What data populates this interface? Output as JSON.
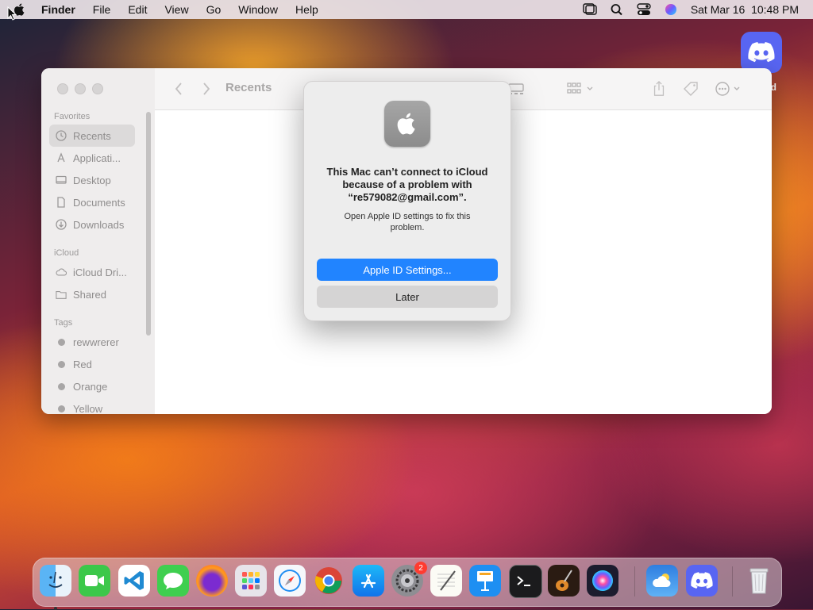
{
  "menubar": {
    "app_name": "Finder",
    "items": [
      "File",
      "Edit",
      "View",
      "Go",
      "Window",
      "Help"
    ],
    "clock": "Sat Mar 16  10:48 PM",
    "status_icons": [
      "stage-manager-icon",
      "search-icon",
      "control-center-icon",
      "siri-icon"
    ]
  },
  "desktop": {
    "icon_name": "discord-icon",
    "label": "rd"
  },
  "finder": {
    "title": "Recents",
    "sidebar": {
      "favorites_title": "Favorites",
      "favorites": [
        {
          "label": "Recents",
          "icon": "clock-icon"
        },
        {
          "label": "Applicati...",
          "icon": "applications-icon"
        },
        {
          "label": "Desktop",
          "icon": "desktop-icon"
        },
        {
          "label": "Documents",
          "icon": "document-icon"
        },
        {
          "label": "Downloads",
          "icon": "download-icon"
        }
      ],
      "icloud_title": "iCloud",
      "icloud": [
        {
          "label": "iCloud Dri...",
          "icon": "cloud-icon"
        },
        {
          "label": "Shared",
          "icon": "shared-folder-icon"
        }
      ],
      "tags_title": "Tags",
      "tags": [
        {
          "label": "rewwrerer",
          "color": "#a8a6a6"
        },
        {
          "label": "Red",
          "color": "#a8a6a6"
        },
        {
          "label": "Orange",
          "color": "#a8a6a6"
        },
        {
          "label": "Yellow",
          "color": "#a8a6a6"
        }
      ]
    }
  },
  "alert": {
    "icon": "apple-logo-icon",
    "title": "This Mac can’t connect to iCloud because of a problem with “re579082@gmail.com”.",
    "message": "Open Apple ID settings to fix this problem.",
    "primary_button": "Apple ID Settings...",
    "secondary_button": "Later",
    "primary_color": "#2184ff"
  },
  "dock": {
    "apps": [
      {
        "name": "Finder",
        "icon": "finder-icon"
      },
      {
        "name": "FaceTime",
        "icon": "facetime-icon"
      },
      {
        "name": "Visual Studio Code",
        "icon": "vscode-icon"
      },
      {
        "name": "Messages",
        "icon": "messages-icon"
      },
      {
        "name": "Firefox",
        "icon": "firefox-icon"
      },
      {
        "name": "Launchpad",
        "icon": "launchpad-icon"
      },
      {
        "name": "Safari",
        "icon": "safari-icon"
      },
      {
        "name": "Chrome",
        "icon": "chrome-icon"
      },
      {
        "name": "App Store",
        "icon": "app-store-icon"
      },
      {
        "name": "System Settings",
        "icon": "system-settings-icon",
        "badge": "2"
      },
      {
        "name": "TextEdit",
        "icon": "textedit-icon"
      },
      {
        "name": "Keynote",
        "icon": "keynote-icon"
      },
      {
        "name": "Terminal",
        "icon": "terminal-icon"
      },
      {
        "name": "GarageBand",
        "icon": "garageband-icon"
      },
      {
        "name": "Siri",
        "icon": "siri-icon"
      },
      {
        "name": "Weather",
        "icon": "weather-icon"
      },
      {
        "name": "Discord",
        "icon": "discord-icon"
      },
      {
        "name": "Trash",
        "icon": "trash-icon"
      }
    ]
  }
}
